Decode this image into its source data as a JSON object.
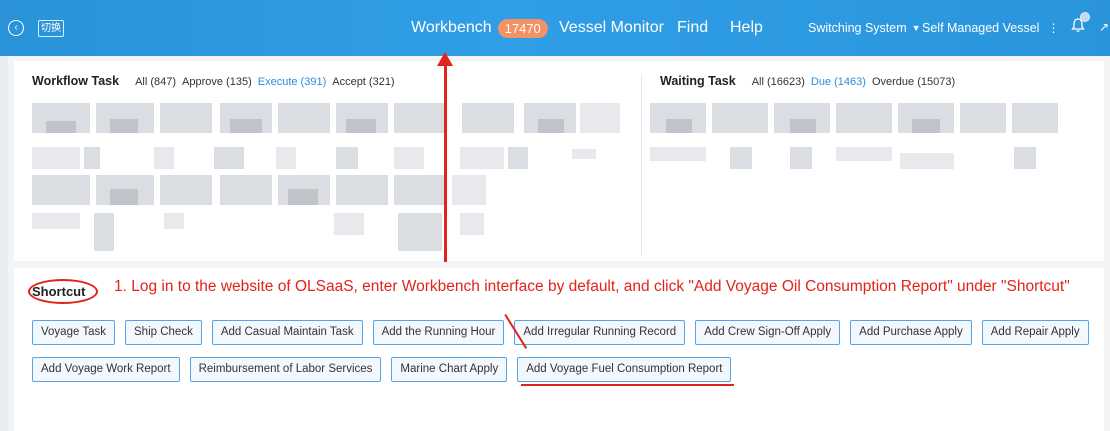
{
  "topbar": {
    "back_icon": "circle-arrow-left-icon",
    "logo_text": "切换",
    "nav": {
      "workbench_label": "Workbench",
      "workbench_badge": "17470",
      "vessel_monitor_label": "Vessel Monitor",
      "find_label": "Find",
      "help_label": "Help"
    },
    "switching_system_label": "Switching System",
    "self_managed_vessel_label": "Self Managed Vessel",
    "colors": {
      "bar": "#2f9ee6",
      "badge": "#f39265"
    }
  },
  "workflow_task": {
    "title": "Workflow Task",
    "tabs": [
      {
        "label": "All (847)",
        "active": false
      },
      {
        "label": "Approve (135)",
        "active": false
      },
      {
        "label": "Execute (391)",
        "active": true
      },
      {
        "label": "Accept (321)",
        "active": false
      }
    ]
  },
  "waiting_task": {
    "title": "Waiting Task",
    "tabs": [
      {
        "label": "All (16623)",
        "active": false
      },
      {
        "label": "Due (1463)",
        "active": true
      },
      {
        "label": "Overdue (15073)",
        "active": false
      }
    ]
  },
  "shortcut": {
    "title": "Shortcut",
    "instruction": "1. Log in to the website of OLSaaS, enter Workbench interface by default, and click \"Add Voyage Oil Consumption Report\" under \"Shortcut\"",
    "row1": [
      "Voyage Task",
      "Ship Check",
      "Add Casual Maintain Task",
      "Add the Running Hour",
      "Add Irregular Running Record",
      "Add Crew Sign-Off Apply",
      "Add Purchase Apply",
      "Add Repair Apply"
    ],
    "row2": [
      "Add Voyage Work Report",
      "Reimbursement of Labor Services",
      "Marine Chart Apply",
      "Add Voyage Fuel Consumption Report"
    ]
  },
  "annotation_color": "#e2231a"
}
